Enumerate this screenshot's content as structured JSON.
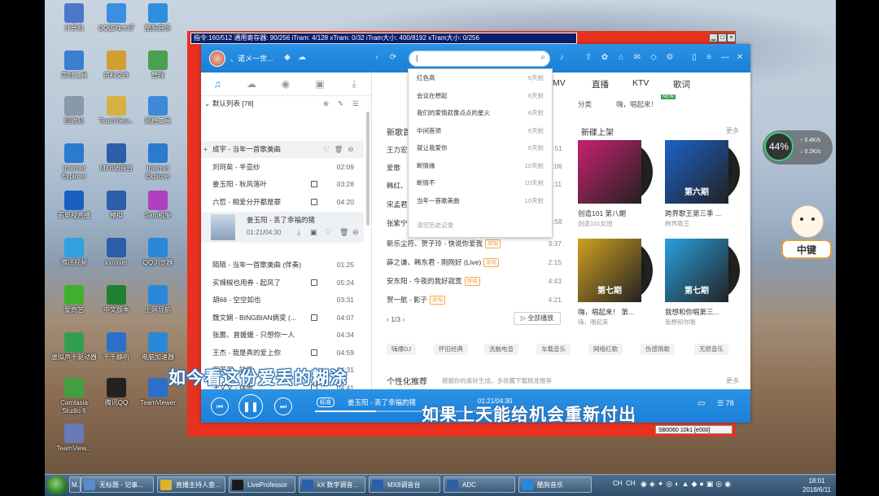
{
  "desktop": {
    "icons": [
      {
        "label": "计算机",
        "color": "#4c78c8"
      },
      {
        "label": "QQ游戏大厅",
        "color": "#3b8fe0"
      },
      {
        "label": "酷狗音乐",
        "color": "#2e8fe0"
      },
      {
        "label": "实时工具",
        "color": "#3a7fd0"
      },
      {
        "label": "资料文件",
        "color": "#d0a030"
      },
      {
        "label": "管理",
        "color": "#4aa050"
      },
      {
        "label": "回收站",
        "color": "#8899aa"
      },
      {
        "label": "TeamView...",
        "color": "#d6b040"
      },
      {
        "label": "网络工具",
        "color": "#3c8ad8"
      },
      {
        "label": "Internet Explorer",
        "color": "#2a7ad0"
      },
      {
        "label": "MX8调音台",
        "color": "#2b5fa8"
      },
      {
        "label": "Internet Explorer",
        "color": "#2a7ad0"
      },
      {
        "label": "看电视直播",
        "color": "#1a60c0"
      },
      {
        "label": "模拟",
        "color": "#2b5fa8"
      },
      {
        "label": "Sam机架",
        "color": "#b040c0"
      },
      {
        "label": "腾讯视频",
        "color": "#30a0e0"
      },
      {
        "label": "kxmixer",
        "color": "#2b5fa8"
      },
      {
        "label": "QQ浏览器",
        "color": "#2a88d8"
      },
      {
        "label": "爱奇艺",
        "color": "#40b030"
      },
      {
        "label": "中文版本",
        "color": "#208030"
      },
      {
        "label": "上网导航",
        "color": "#2a88d8"
      },
      {
        "label": "虚拟声卡驱动器",
        "color": "#30a050"
      },
      {
        "label": "千千静听",
        "color": "#2a70c8"
      },
      {
        "label": "电脑加速器",
        "color": "#2a88d8"
      },
      {
        "label": "Camtasia Studio 6",
        "color": "#40a040"
      },
      {
        "label": "腾讯QQ",
        "color": "#222222"
      },
      {
        "label": "TeamViewer",
        "color": "#2a70c8"
      },
      {
        "label": "TeamView...",
        "color": "#6a7ab8"
      }
    ]
  },
  "debug_window": {
    "title": "指令:160/512 通用寄存器: 90/256 iTram: 4/128 xTram: 0/32 iTram大小: 400/8192 xTram大小: 0/256",
    "status": "SB0060 10k1 [e000]"
  },
  "player": {
    "user_name": "、诺メ一世...",
    "search_value": "|",
    "search_history": [
      {
        "text": "红色高",
        "count": "6天前"
      },
      {
        "text": "会议在想起",
        "count": "6天前"
      },
      {
        "text": "我们的爱情就像点点的星火",
        "count": "6天前"
      },
      {
        "text": "中间首领",
        "count": "6天前"
      },
      {
        "text": "就让我爱你",
        "count": "6天前"
      },
      {
        "text": "断情缘",
        "count": "10天前"
      },
      {
        "text": "断情不",
        "count": "10天前"
      },
      {
        "text": "当年一首歌美曲",
        "count": "10天前"
      }
    ],
    "search_clear": "清空历史记录",
    "playlist_header": "默认列表 [78]",
    "songs": [
      {
        "title": "成宇 - 当年一首歌美曲",
        "dur": ""
      },
      {
        "title": "刘珂矣 - 半壶纱",
        "dur": "02:09"
      },
      {
        "title": "姜玉阳 - 秋风落叶",
        "dur": "03:28"
      },
      {
        "title": "六哲 - 相爱分开都是罪",
        "dur": "04:20"
      },
      {
        "title": "陌陌 - 当年一首歌美曲 (伴奏)",
        "dur": "01:25"
      },
      {
        "title": "买辣椒也用券 - 起风了",
        "dur": "05:24"
      },
      {
        "title": "胡66 - 空空如也",
        "dur": "03:31"
      },
      {
        "title": "魏文娴 - BINGBIAN病变 (...",
        "dur": "04:07"
      },
      {
        "title": "张震、曾媛媛 - 只想你一人",
        "dur": "04:34"
      },
      {
        "title": "王杰 - 我是真的爱上你",
        "dur": "04:59"
      },
      {
        "title": "安苏羽 - 缺氧",
        "dur": "04:31"
      },
      {
        "title": "于文文 - 体面",
        "dur": "04:41"
      },
      {
        "title": "苏勒亚其其格 - 歌在飞",
        "dur": "04:04"
      }
    ],
    "now_playing": {
      "title": "姜玉阳 - 丢了幸福的猪",
      "time": "01:21/04:30"
    },
    "nav": [
      "MV",
      "直播",
      "KTV",
      "歌词"
    ],
    "subnav": [
      "分类",
      "嗨，唱起来！"
    ],
    "new_tag": "NEW",
    "new_songs_title": "新歌首",
    "new_songs_partial": [
      "王力宏",
      "爱歌",
      "韩红、",
      "宋孟君",
      "张紫宁"
    ],
    "new_song_rows": [
      {
        "title": "新乐尘符、贺子玲 - 快说你爱我",
        "dur": "3:37",
        "tag": "原唱"
      },
      {
        "title": "薛之谦、韩东君 - 刚刚好 (Live)",
        "dur": "2:15",
        "tag": "原唱"
      },
      {
        "title": "安东阳 - 今夜的我好寂寞",
        "dur": "4:43",
        "tag": "原唱"
      },
      {
        "title": "贺一航 - 影子",
        "dur": "4:21",
        "tag": "原唱"
      }
    ],
    "page": "1/3",
    "play_all": "全部播放",
    "new_albums_title": "新碟上架",
    "more": "更多",
    "albums": [
      {
        "title": "创造101 第八期",
        "sub": "创造101女团",
        "color": "#c9206f",
        "disc_label": ""
      },
      {
        "title": "跨界歌王第三季 ...",
        "sub": "跨界歌王",
        "color": "#1c62c8",
        "disc_label": "第六期"
      },
      {
        "title": "嗨，唱起来！ 第...",
        "sub": "嗨，唱起来",
        "color": "#d0a020",
        "disc_label": "第七期"
      },
      {
        "title": "我想和你唱第三...",
        "sub": "我想和你唱",
        "color": "#2aa0e0",
        "disc_label": "第七期"
      }
    ],
    "chips": [
      "嗨爆DJ",
      "怀旧经典",
      "洗脑电音",
      "车载音乐",
      "网络红歌",
      "伤感情歌",
      "无损音乐"
    ],
    "personal_title": "个性化推荐",
    "personal_sub": "根据你的喜好生成，多收藏下载精准推荐",
    "bottom": {
      "quality": "标准",
      "song": "姜玉阳 - 丢了幸福的猪",
      "time": "01:21/04:30",
      "count": "78"
    }
  },
  "subtitles": {
    "line1": "如今看这份爱丢的糊涂",
    "line2": "如果上天能给机会重新付出"
  },
  "speed_widget": {
    "percent": "44%",
    "up": "0.4K/s",
    "down": "0.2K/s"
  },
  "mascot_text": "中键",
  "taskbar": {
    "items": [
      {
        "label": "M...",
        "color": "#d0d0d0"
      },
      {
        "label": "无标题 - 记事...",
        "color": "#5a8ad0"
      },
      {
        "label": "直播主持人查...",
        "color": "#e0b030"
      },
      {
        "label": "LiveProfessor",
        "color": "#1a1a1a"
      },
      {
        "label": "kX 数字调音...",
        "color": "#2b5fa8"
      },
      {
        "label": "MX8调音台",
        "color": "#2b5fa8"
      },
      {
        "label": "ADC",
        "color": "#2b5fa8"
      },
      {
        "label": "酷狗音乐",
        "color": "#2a88d8"
      }
    ],
    "tray": [
      "CH",
      "CH"
    ],
    "time": "18:01",
    "date": "2018/6/11"
  }
}
